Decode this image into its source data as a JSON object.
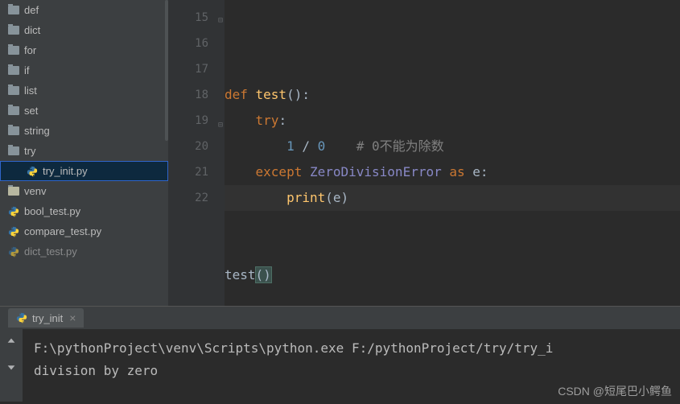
{
  "sidebar": {
    "items": [
      {
        "label": "def",
        "type": "folder"
      },
      {
        "label": "dict",
        "type": "folder"
      },
      {
        "label": "for",
        "type": "folder"
      },
      {
        "label": "if",
        "type": "folder"
      },
      {
        "label": "list",
        "type": "folder"
      },
      {
        "label": "set",
        "type": "folder"
      },
      {
        "label": "string",
        "type": "folder"
      },
      {
        "label": "try",
        "type": "folder"
      },
      {
        "label": "try_init.py",
        "type": "py",
        "indent": true,
        "selected": true
      },
      {
        "label": "venv",
        "type": "folder-venv"
      },
      {
        "label": "bool_test.py",
        "type": "py"
      },
      {
        "label": "compare_test.py",
        "type": "py"
      },
      {
        "label": "dict_test.py",
        "type": "py"
      }
    ]
  },
  "editor": {
    "line_start": 15,
    "lines": [
      {
        "n": 15,
        "tokens": [
          "kw:def ",
          "fn:test",
          "p:():"
        ]
      },
      {
        "n": 16,
        "tokens": [
          "p:    ",
          "kw:try",
          "p::"
        ]
      },
      {
        "n": 17,
        "tokens": [
          "p:        ",
          "num:1",
          "p: / ",
          "num:0",
          "p:    ",
          "cm:# 0不能为除数"
        ]
      },
      {
        "n": 18,
        "tokens": [
          "p:    ",
          "kw:except ",
          "ex:ZeroDivisionError ",
          "kw:as ",
          "p:e:"
        ]
      },
      {
        "n": 19,
        "tokens": [
          "p:        ",
          "fn:print",
          "p:(e)"
        ]
      },
      {
        "n": 20,
        "tokens": []
      },
      {
        "n": 21,
        "tokens": []
      },
      {
        "n": 22,
        "tokens": [
          "p:test",
          "paren:()"
        ]
      }
    ]
  },
  "run_tab": {
    "label": "try_init",
    "close": "×"
  },
  "console": {
    "line1": "F:\\pythonProject\\venv\\Scripts\\python.exe F:/pythonProject/try/try_i",
    "line2": "division by zero"
  },
  "watermark": "CSDN @短尾巴小鳄鱼"
}
